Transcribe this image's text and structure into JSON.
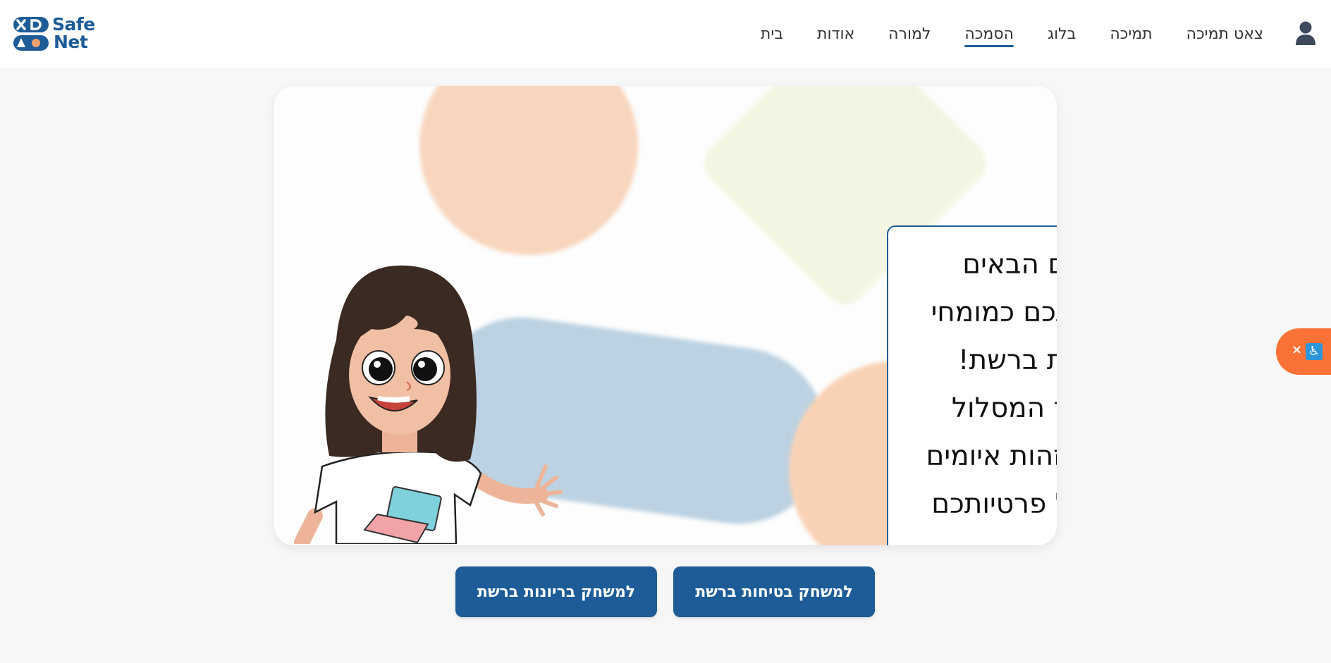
{
  "brand": {
    "name_line1": "Safe",
    "name_line2": "Net",
    "color": "#1d5c96",
    "mark_icons": [
      "x-icon",
      "d-shape-icon",
      "triangle-icon",
      "circle-icon"
    ]
  },
  "nav": {
    "items": [
      {
        "label": "בית",
        "active": false
      },
      {
        "label": "אודות",
        "active": false
      },
      {
        "label": "למורה",
        "active": false
      },
      {
        "label": "הסמכה",
        "active": true
      },
      {
        "label": "בלוג",
        "active": false
      },
      {
        "label": "תמיכה",
        "active": false
      },
      {
        "label": "צאט תמיכה",
        "active": false
      }
    ],
    "user_icon": "user-icon"
  },
  "hero": {
    "welcome_text": "ברוכים הבאים להכשרתכם כמומחי בטיחות ברשת! במהלך המסלול תלמדו לזהות איומים ולהגן על פרטיותכם ברשת.",
    "illustration": "girl-with-laptop-shirt-waving"
  },
  "buttons": {
    "safety_game": "למשחק בטיחות ברשת",
    "bullying_game": "למשחק בריונות ברשת"
  },
  "accessibility": {
    "close_label": "×",
    "icon": "wheelchair-icon",
    "color": "#fb7236"
  }
}
